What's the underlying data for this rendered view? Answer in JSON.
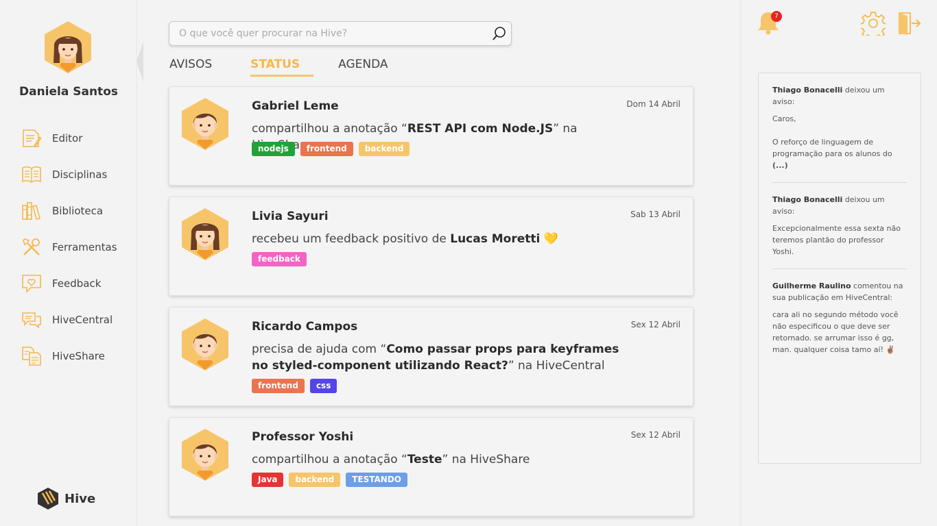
{
  "user": {
    "name": "Daniela Santos"
  },
  "nav": [
    {
      "label": "Editor",
      "icon": "editor-icon"
    },
    {
      "label": "Disciplinas",
      "icon": "book-icon"
    },
    {
      "label": "Biblioteca",
      "icon": "library-icon"
    },
    {
      "label": "Ferramentas",
      "icon": "tools-icon"
    },
    {
      "label": "Feedback",
      "icon": "feedback-heart-icon"
    },
    {
      "label": "HiveCentral",
      "icon": "chat-icon"
    },
    {
      "label": "HiveShare",
      "icon": "share-docs-icon"
    }
  ],
  "brand": {
    "label": "Hive"
  },
  "search": {
    "placeholder": "O que você quer procurar na Hive?"
  },
  "tabs": [
    {
      "label": "AVISOS"
    },
    {
      "label": "STATUS",
      "active": true
    },
    {
      "label": "AGENDA"
    }
  ],
  "feed": [
    {
      "author": "Gabriel Leme",
      "avatar": "boy",
      "date": "Dom 14 Abril",
      "pre": "compartilhou a anotação “",
      "bold": "REST API com Node.JS",
      "post": "” na HiveShare",
      "tags": [
        {
          "label": "nodejs",
          "color": "#22a33a"
        },
        {
          "label": "frontend",
          "color": "#ea7350"
        },
        {
          "label": "backend",
          "color": "#f7c569"
        }
      ]
    },
    {
      "author": "Livia Sayuri",
      "avatar": "girl",
      "date": "Sab 13 Abril",
      "pre": "recebeu um feedback positivo de ",
      "bold": "Lucas Moretti",
      "post": " 💛",
      "tags": [
        {
          "label": "feedback",
          "color": "#f264c4"
        }
      ]
    },
    {
      "author": "Ricardo Campos",
      "avatar": "boy",
      "date": "Sex 12 Abril",
      "pre": "precisa de ajuda com “",
      "bold": "Como passar props para keyframes no styled-component utilizando React?",
      "post": "” na HiveCentral",
      "tags": [
        {
          "label": "frontend",
          "color": "#ea7350"
        },
        {
          "label": "css",
          "color": "#5345e6"
        }
      ]
    },
    {
      "author": "Professor Yoshi",
      "avatar": "boy",
      "date": "Sex 12 Abril",
      "pre": "compartilhou a anotação “",
      "bold": "Teste",
      "post": "” na HiveShare",
      "tags": [
        {
          "label": "Java",
          "color": "#e53434"
        },
        {
          "label": "backend",
          "color": "#f7c569"
        },
        {
          "label": "TESTANDO",
          "color": "#6d9ee8"
        }
      ]
    }
  ],
  "notifications": {
    "count": "7"
  },
  "notices": [
    {
      "author": "Thiago Bonacelli",
      "action": " deixou um aviso:",
      "lines": [
        "Caros,",
        "O reforço de linguagem de programação para os alunos do "
      ],
      "ellipsis": "(...)"
    },
    {
      "author": "Thiago Bonacelli",
      "action": " deixou um aviso:",
      "lines": [
        "Excepcionalmente essa sexta não teremos plantão do professor Yoshi."
      ]
    },
    {
      "author": "Guilherme Raulino",
      "action": " comentou na sua publicação em HiveCentral:",
      "lines": [
        "cara ali no segundo método você não especificou o que deve ser retornado. se arrumar isso é gg, man. qualquer coisa tamo aí! ✌🏽"
      ]
    }
  ],
  "colors": {
    "accent": "#f7c569",
    "accent_dark": "#f5b84a"
  }
}
